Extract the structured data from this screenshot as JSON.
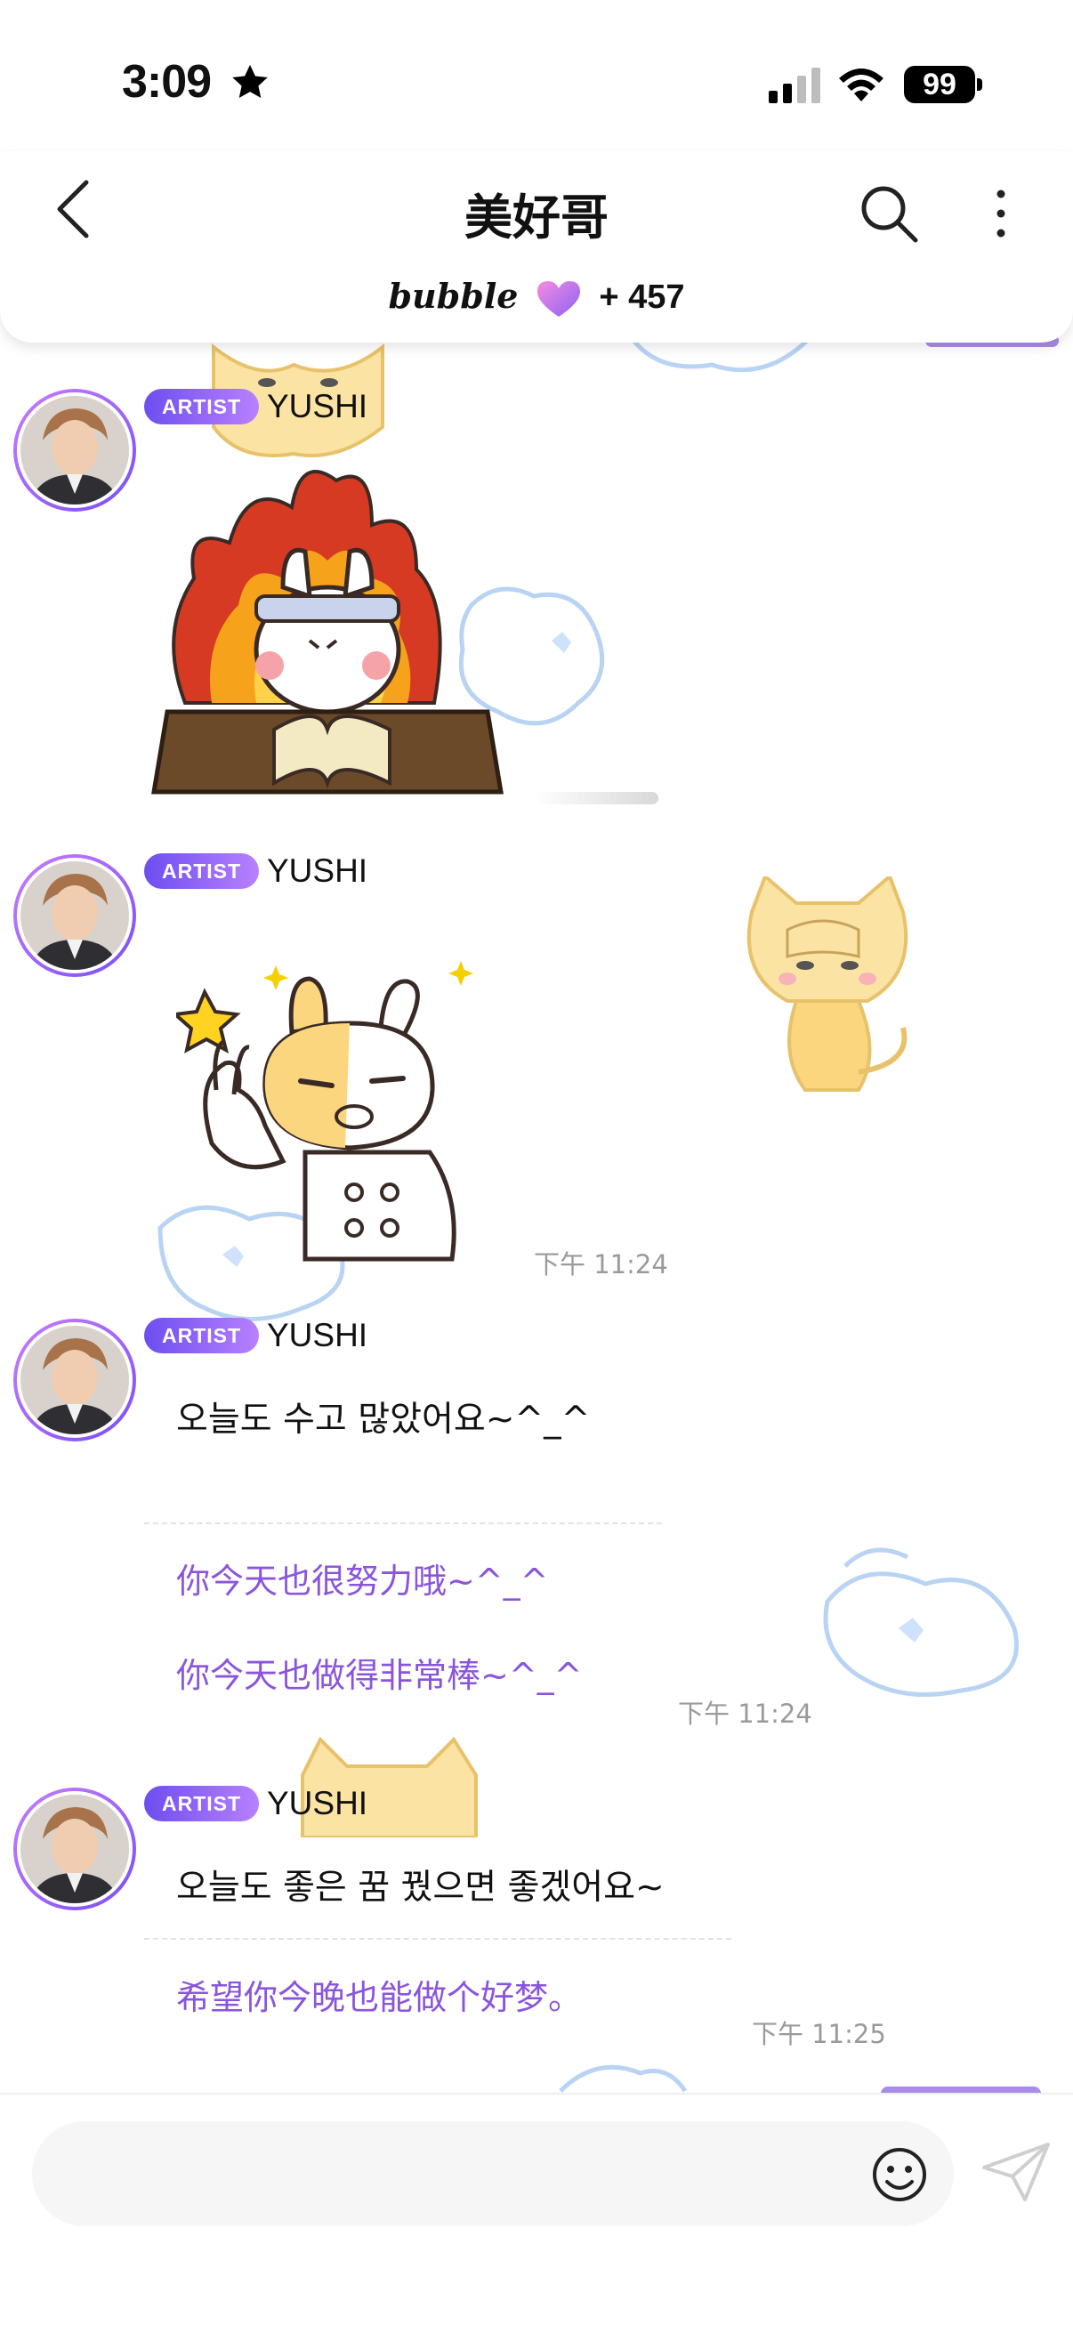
{
  "status_bar": {
    "time": "3:09",
    "battery": "99"
  },
  "header": {
    "title": "美好哥",
    "bubble_logo": "bubble",
    "bubble_count": "+ 457"
  },
  "messages": [
    {
      "badge": "ARTIST",
      "sender": "YUSHI",
      "type": "sticker"
    },
    {
      "badge": "ARTIST",
      "sender": "YUSHI",
      "type": "sticker",
      "time": "下午 11:24"
    },
    {
      "badge": "ARTIST",
      "sender": "YUSHI",
      "text": "오늘도 수고 많았어요~^_^",
      "translations": [
        "你今天也很努力哦~^_^",
        "你今天也做得非常棒~^_^"
      ],
      "time": "下午 11:24"
    },
    {
      "badge": "ARTIST",
      "sender": "YUSHI",
      "text": "오늘도 좋은 꿈 꿨으면 좋겠어요~",
      "translations": [
        "希望你今晚也能做个好梦。"
      ],
      "time": "下午 11:25"
    }
  ],
  "input": {
    "placeholder": ""
  },
  "icons": {
    "back": "chevron-left-icon",
    "search": "search-icon",
    "more": "more-vertical-icon",
    "emoji": "smiley-icon",
    "send": "paper-plane-icon"
  },
  "colors": {
    "accent_purple": "#8a55dc",
    "badge_start": "#6d4ef0",
    "badge_end": "#b880ff"
  }
}
